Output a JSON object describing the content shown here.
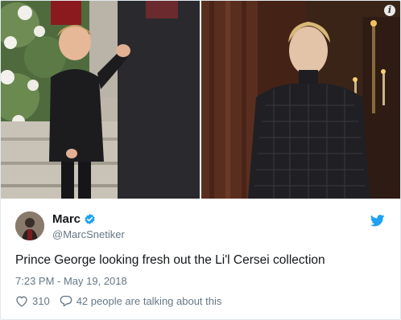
{
  "tweet": {
    "author_name": "Marc",
    "author_handle": "@MarcSnetiker",
    "text": "Prince George looking fresh out the Li'l Cersei collection",
    "timestamp": "7:23 PM - May 19, 2018",
    "likes": "310",
    "conversation": "42 people are talking about this",
    "verified": true
  },
  "media": {
    "left_photo": "boy-in-black-coat-photo",
    "right_photo": "woman-in-black-dress-photo",
    "info_symbol": "i"
  },
  "icons": {
    "verified": "verified-badge-icon",
    "brand": "twitter-bird-icon",
    "like": "heart-icon",
    "reply": "speech-bubble-icon",
    "info": "info-icon"
  },
  "colors": {
    "brand": "#1da1f2",
    "text": "#14171a",
    "muted": "#657786",
    "border": "#e1e8ed"
  }
}
